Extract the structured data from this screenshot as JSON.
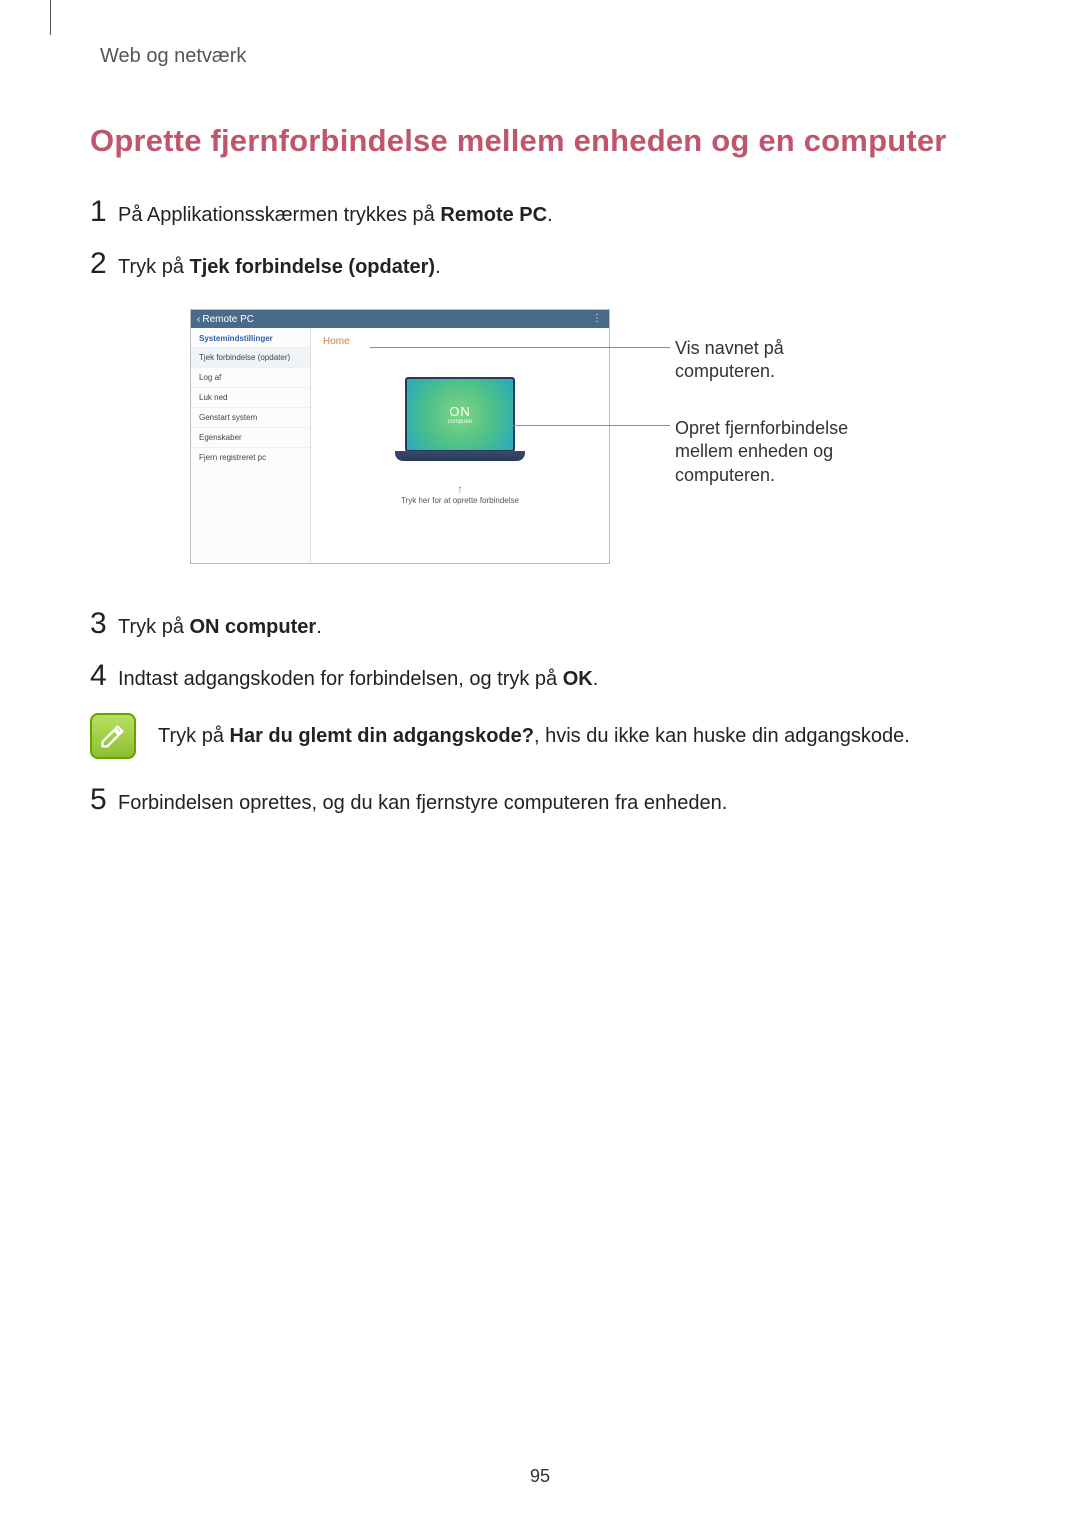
{
  "breadcrumb": "Web og netværk",
  "title": "Oprette fjernforbindelse mellem enheden og en computer",
  "steps": {
    "s1_pre": "På Applikationsskærmen trykkes på ",
    "s1_bold": "Remote PC",
    "s1_post": ".",
    "s2_pre": "Tryk på ",
    "s2_bold": "Tjek forbindelse (opdater)",
    "s2_post": ".",
    "s3_pre": "Tryk på ",
    "s3_bold": "ON computer",
    "s3_post": ".",
    "s4_pre": "Indtast adgangskoden for forbindelsen, og tryk på ",
    "s4_bold": "OK",
    "s4_post": ".",
    "s5": "Forbindelsen oprettes, og du kan fjernstyre computeren fra enheden."
  },
  "note_pre": "Tryk på ",
  "note_bold": "Har du glemt din adgangskode?",
  "note_post": ", hvis du ikke kan huske din adgangskode.",
  "figure": {
    "header_title": "Remote PC",
    "sidebar_title": "Systemindstillinger",
    "sidebar_items": [
      "Tjek forbindelse (opdater)",
      "Log af",
      "Luk ned",
      "Genstart system",
      "Egenskaber",
      "Fjern registreret pc"
    ],
    "home_label": "Home",
    "on_big": "ON",
    "on_small": "computer",
    "hint_text": "Tryk her for at oprette forbindelse"
  },
  "callout1": "Vis navnet på computeren.",
  "callout2": "Opret fjernforbindelse mellem enheden og computeren.",
  "page_number": "95"
}
